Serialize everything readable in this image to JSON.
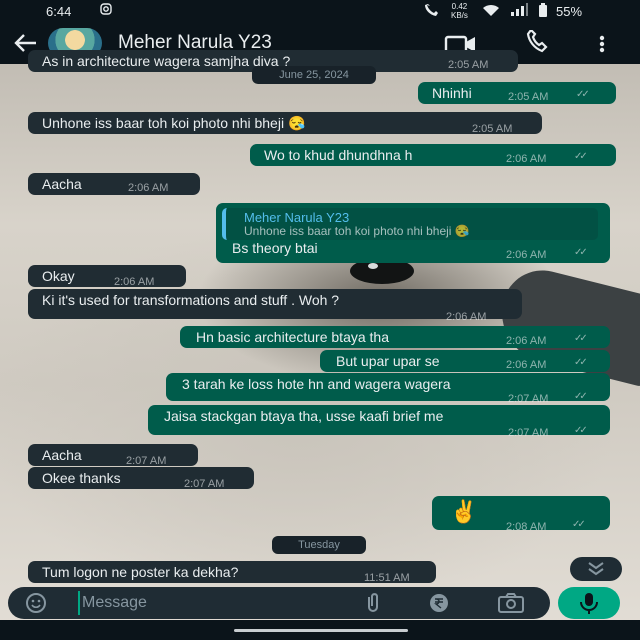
{
  "status_bar": {
    "time": "6:44",
    "net_speed_value": "0.42",
    "net_speed_unit": "KB/s",
    "battery": "55%",
    "icons": [
      "instagram-icon",
      "wifi-calling-icon",
      "wifi-icon",
      "signal-icon",
      "battery-icon"
    ]
  },
  "header": {
    "contact_name": "Meher Narula Y23",
    "icons": [
      "back-arrow-icon",
      "video-call-icon",
      "voice-call-icon",
      "more-options-icon"
    ]
  },
  "date_chips": {
    "june": "June 25, 2024",
    "tuesday": "Tuesday"
  },
  "messages": [
    {
      "dir": "in",
      "text": "As in architecture wagera samjha diya ?",
      "time": "2:05 AM"
    },
    {
      "dir": "out",
      "text": "Nhinhi",
      "time": "2:05 AM"
    },
    {
      "dir": "in",
      "text": "Unhone iss baar toh koi photo nhi bheji 😪",
      "time": "2:05 AM"
    },
    {
      "dir": "out",
      "text": "Wo to khud dhundhna h",
      "time": "2:06 AM"
    },
    {
      "dir": "in",
      "text": "Aacha",
      "time": "2:06 AM"
    },
    {
      "dir": "out",
      "text": "Bs theory btai",
      "time": "2:06 AM",
      "reply": {
        "author": "Meher Narula Y23",
        "text": "Unhone iss baar toh koi photo nhi bheji 😪"
      }
    },
    {
      "dir": "in",
      "text": "Okay",
      "time": "2:06 AM"
    },
    {
      "dir": "in",
      "text": "Ki it's used for transformations and stuff . Woh ?",
      "time": "2:06 AM"
    },
    {
      "dir": "out",
      "text": "Hn basic architecture btaya tha",
      "time": "2:06 AM"
    },
    {
      "dir": "out",
      "text": "But upar upar se",
      "time": "2:06 AM"
    },
    {
      "dir": "out",
      "text": "3 tarah ke loss hote hn and wagera wagera",
      "time": "2:07 AM"
    },
    {
      "dir": "out",
      "text": "Jaisa stackgan btaya tha, usse kaafi brief me",
      "time": "2:07 AM"
    },
    {
      "dir": "in",
      "text": "Aacha",
      "time": "2:07 AM"
    },
    {
      "dir": "in",
      "text": "Okee thanks",
      "time": "2:07 AM"
    },
    {
      "dir": "out",
      "text": "✌️",
      "time": "2:08 AM"
    },
    {
      "dir": "in",
      "text": "Tum logon ne poster ka dekha?",
      "time": "11:51 AM"
    }
  ],
  "composer": {
    "placeholder": "Message",
    "icons": [
      "emoji-icon",
      "attach-icon",
      "rupee-payment-icon",
      "camera-icon",
      "mic-icon"
    ]
  },
  "colors": {
    "incoming_bubble": "#202c33",
    "outgoing_bubble": "#005c4b",
    "accent_green": "#00a884",
    "read_ticks": "#8696a0",
    "reply_bar": "#53bdeb"
  }
}
